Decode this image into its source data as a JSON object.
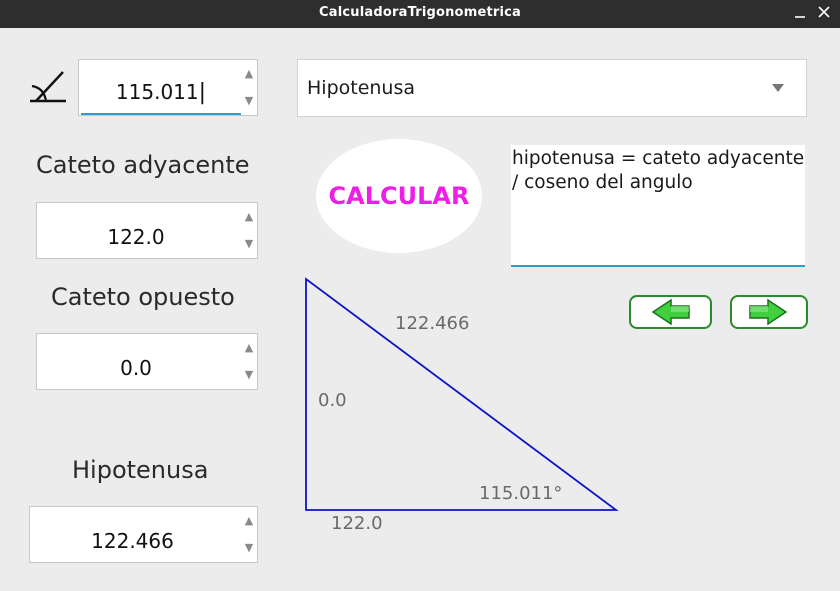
{
  "window": {
    "title": "CalculadoraTrigonometrica"
  },
  "angle": {
    "icon": "angle-icon",
    "value": "115.011",
    "cursor": "|"
  },
  "fields": {
    "adjacent_label": "Cateto adyacente",
    "adjacent_value": "122.0",
    "opposite_label": "Cateto opuesto",
    "opposite_value": "0.0",
    "hypotenuse_label": "Hipotenusa",
    "hypotenuse_value": "122.466"
  },
  "spinner_arrows": {
    "up": "▲",
    "down": "▼"
  },
  "target_select": {
    "selected": "Hipotenusa"
  },
  "calculate_button": {
    "label": "CALCULAR",
    "color": "#ee1ee6"
  },
  "formula": {
    "text": "hipotenusa = cateto adyacente / coseno del angulo"
  },
  "navigation": {
    "prev_icon": "arrow-left-icon",
    "next_icon": "arrow-right-icon",
    "accent": "#2a8b2a"
  },
  "triangle": {
    "hypotenuse_label": "122.466",
    "opposite_label": "0.0",
    "angle_label": "115.011°",
    "adjacent_label": "122.0",
    "line_color": "#0a14c8"
  }
}
